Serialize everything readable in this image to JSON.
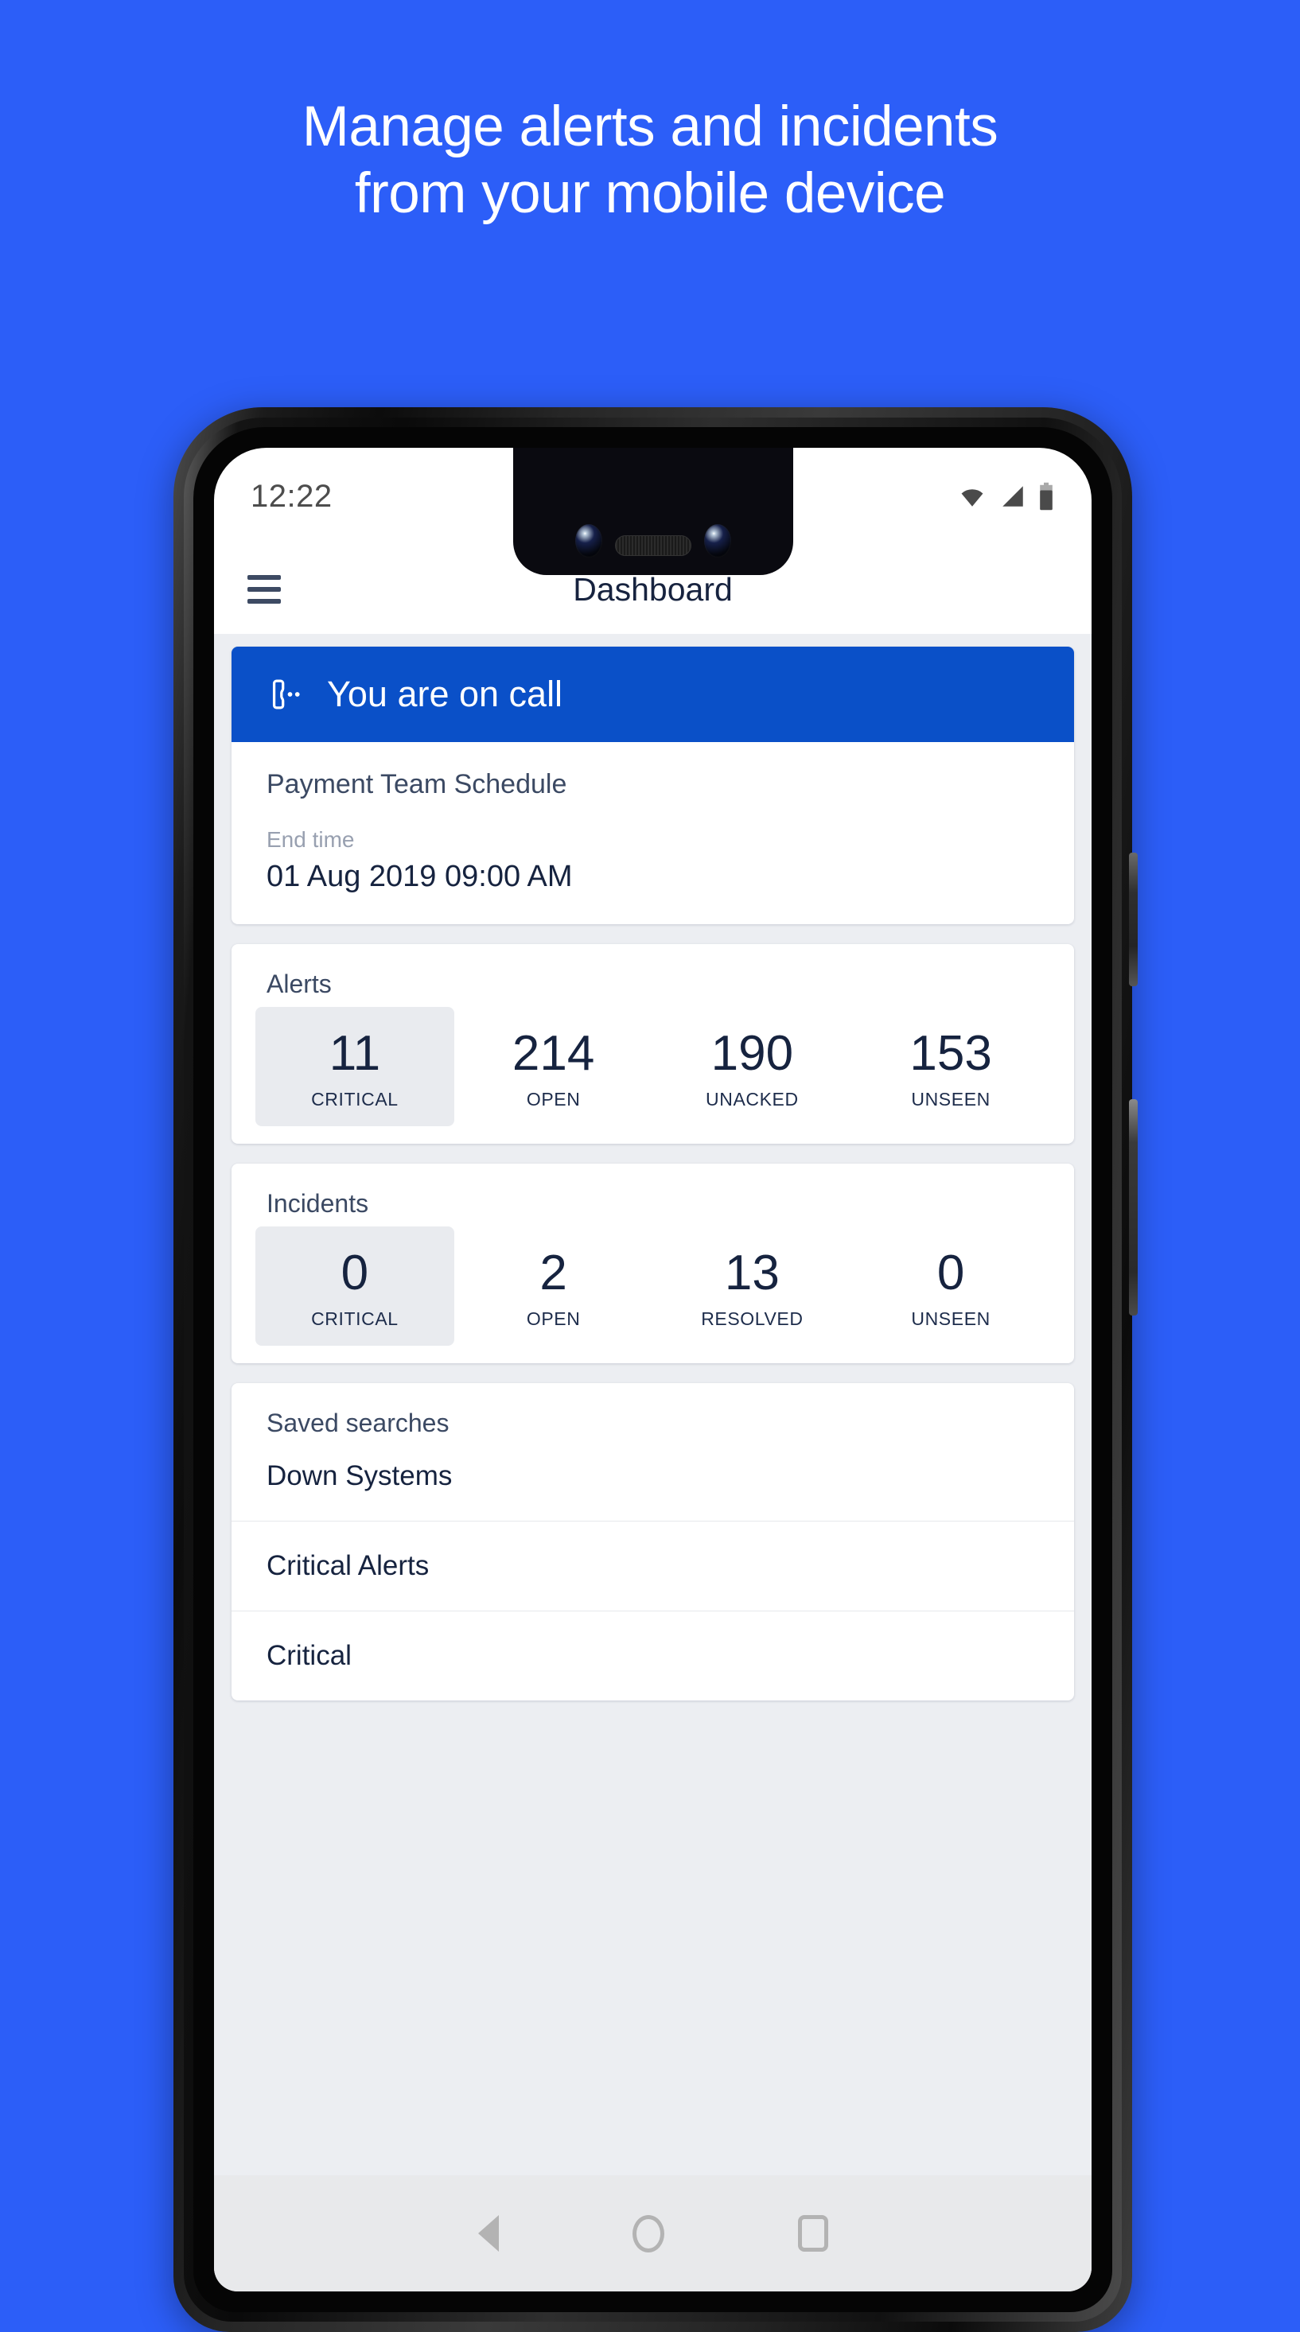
{
  "promo": {
    "headline": "Manage alerts and incidents\nfrom your mobile device",
    "background_color": "#2C5EF8"
  },
  "phone": {
    "status_bar": {
      "time": "12:22",
      "icons": [
        "wifi-icon",
        "cellular-signal-icon",
        "battery-icon"
      ]
    },
    "app_bar": {
      "menu_icon": "hamburger-menu-icon",
      "title": "Dashboard"
    },
    "nav_bar": {
      "back": "back-triangle-icon",
      "home": "home-circle-icon",
      "recents": "recents-square-icon"
    }
  },
  "on_call": {
    "icon": "phone-in-talk-icon",
    "banner_text": "You are on call",
    "banner_color": "#0A50C8",
    "schedule_name": "Payment Team Schedule",
    "end_time_label": "End time",
    "end_time_value": "01 Aug 2019 09:00 AM"
  },
  "alerts": {
    "title": "Alerts",
    "stats": [
      {
        "value": "11",
        "label": "CRITICAL",
        "highlight": true
      },
      {
        "value": "214",
        "label": "OPEN",
        "highlight": false
      },
      {
        "value": "190",
        "label": "UNACKED",
        "highlight": false
      },
      {
        "value": "153",
        "label": "UNSEEN",
        "highlight": false
      }
    ]
  },
  "incidents": {
    "title": "Incidents",
    "stats": [
      {
        "value": "0",
        "label": "CRITICAL",
        "highlight": true
      },
      {
        "value": "2",
        "label": "OPEN",
        "highlight": false
      },
      {
        "value": "13",
        "label": "RESOLVED",
        "highlight": false
      },
      {
        "value": "0",
        "label": "UNSEEN",
        "highlight": false
      }
    ]
  },
  "saved_searches": {
    "title": "Saved searches",
    "items": [
      "Down Systems",
      "Critical Alerts",
      "Critical"
    ]
  }
}
